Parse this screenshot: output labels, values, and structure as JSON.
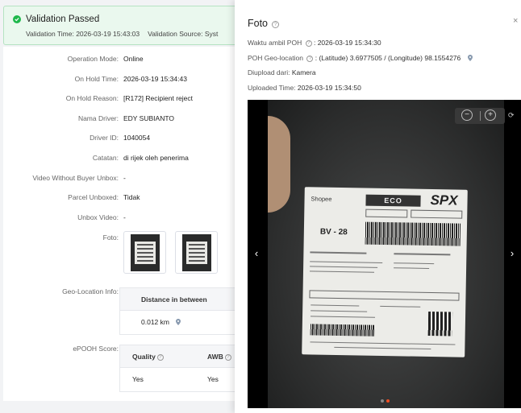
{
  "banner": {
    "title": "Validation Passed",
    "validation_time": "Validation Time: 2026-03-19 15:43:03",
    "validation_source": "Validation Source: Syst"
  },
  "details": [
    {
      "label": "Operation Mode:",
      "value": "Online"
    },
    {
      "label": "On Hold Time:",
      "value": "2026-03-19 15:34:43"
    },
    {
      "label": "On Hold Reason:",
      "value": "[R172] Recipient reject"
    },
    {
      "label": "Nama Driver:",
      "value": "EDY SUBIANTO"
    },
    {
      "label": "Driver ID:",
      "value": "1040054"
    },
    {
      "label": "Catatan:",
      "value": "di rijek oleh penerima"
    },
    {
      "label": "Video Without Buyer Unbox:",
      "value": "-"
    },
    {
      "label": "Parcel Unboxed:",
      "value": "Tidak"
    },
    {
      "label": "Unbox Video:",
      "value": "-"
    },
    {
      "label": "Foto:",
      "value": ""
    }
  ],
  "geo": {
    "label": "Geo-Location Info:",
    "header": "Distance in between",
    "distance": "0.012 km"
  },
  "epooh": {
    "label": "ePOOH Score:",
    "col1": "Quality",
    "col2": "AWB",
    "val1": "Yes",
    "val2": "Yes"
  },
  "drawer": {
    "title": "Foto",
    "close": "×",
    "waktu_label": "Waktu ambil POH",
    "waktu_value": ": 2026-03-19 15:34:30",
    "geo_label": "POH Geo-location",
    "geo_value": ": (Latitude) 3.6977505 / (Longitude) 98.1554276",
    "diupload_label": "Diupload dari:",
    "diupload_value": "Kamera",
    "uploaded_label": "Uploaded Time:",
    "uploaded_value": "2026-03-19 15:34:50"
  },
  "label_photo": {
    "brand": "Shopee",
    "service": "ECO",
    "carrier": "SPX",
    "sort_code": "BV - 28"
  },
  "icons": [
    "check-circle-icon",
    "help-icon",
    "location-pin-icon",
    "close-icon",
    "zoom-out-icon",
    "zoom-in-icon",
    "rotate-icon",
    "chevron-left-icon",
    "chevron-right-icon"
  ],
  "colors": {
    "success": "#1fb84c",
    "pin": "#8a9bb0",
    "accent_dot": "#f04e23"
  }
}
